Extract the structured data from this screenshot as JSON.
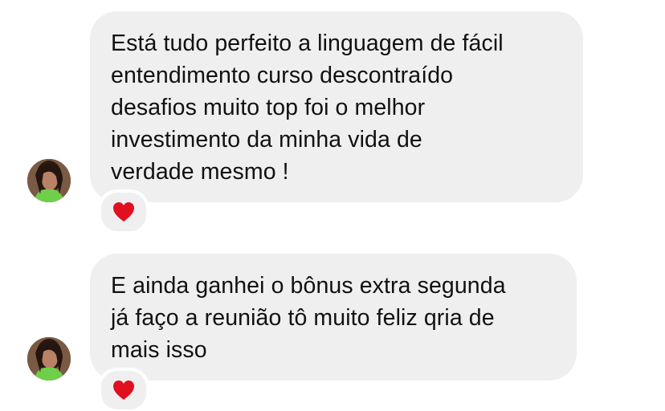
{
  "messages": [
    {
      "lines": [
        "Está tudo perfeito a linguagem de fácil",
        "entendimento curso descontraído",
        "desafios muito top foi o melhor",
        "investimento da minha vida de",
        "verdade mesmo !"
      ],
      "reaction_icon": "heart-icon",
      "reaction_color": "#e0101e"
    },
    {
      "lines": [
        "E ainda ganhei o bônus extra segunda",
        "já faço a reunião tô muito feliz qria de",
        "mais isso"
      ],
      "reaction_icon": "heart-icon",
      "reaction_color": "#e0101e"
    }
  ],
  "colors": {
    "bubble": "#efefef",
    "text": "#111111",
    "background": "#ffffff"
  }
}
